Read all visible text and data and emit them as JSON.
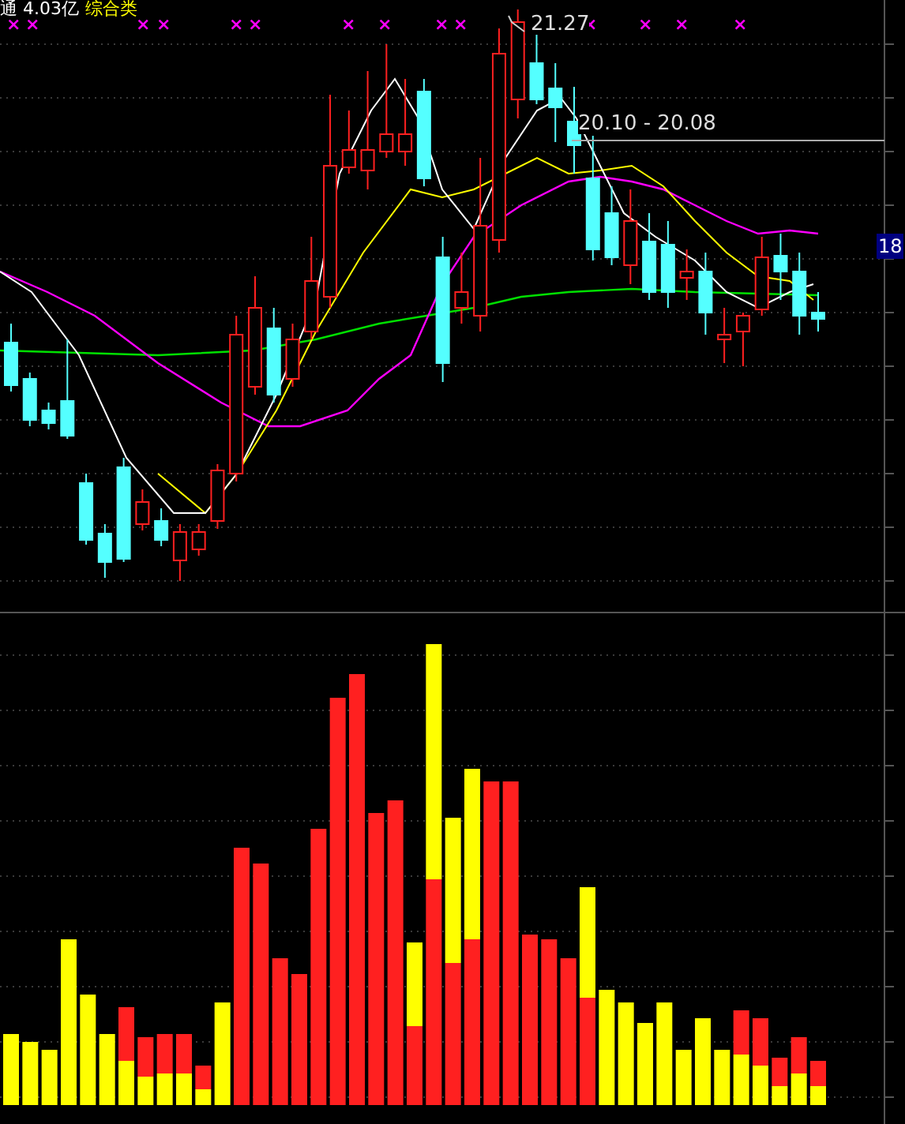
{
  "header": {
    "float_label": "通 4.03亿",
    "sector": "综合类"
  },
  "signal_marks": [
    {
      "text": "×"
    },
    {
      "text": "×"
    },
    {
      "text": "×"
    },
    {
      "text": "×"
    },
    {
      "text": "×"
    },
    {
      "text": "×"
    },
    {
      "text": "×"
    },
    {
      "text": "×"
    },
    {
      "text": "×"
    },
    {
      "text": "×"
    },
    {
      "text": "×"
    },
    {
      "text": "×"
    },
    {
      "text": "×"
    },
    {
      "text": "×"
    }
  ],
  "price_chart": {
    "high_label": "21.27",
    "range_label": "20.10 - 20.08",
    "axis_label": "18"
  }
}
